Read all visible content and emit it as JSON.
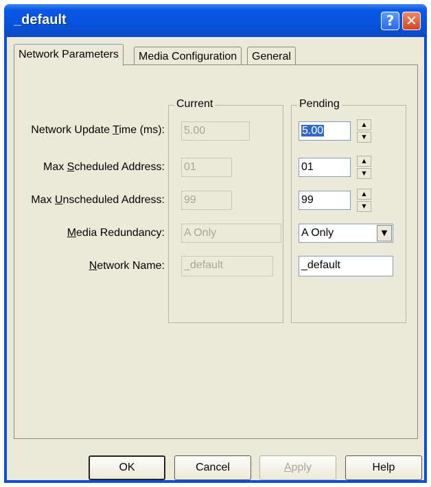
{
  "window": {
    "title": "_default",
    "help_icon": "?",
    "close_icon": "✕"
  },
  "tabs": [
    {
      "label": "Network Parameters",
      "active": true
    },
    {
      "label": "Media Configuration",
      "active": false
    },
    {
      "label": "General",
      "active": false
    }
  ],
  "groups": {
    "current": "Current",
    "pending": "Pending"
  },
  "rows": [
    {
      "label_pre": "Network Update ",
      "label_key": "T",
      "label_post": "ime (ms):",
      "current": "5.00",
      "pending": "5.00"
    },
    {
      "label_pre": "Max ",
      "label_key": "S",
      "label_post": "cheduled Address:",
      "current": "01",
      "pending": "01"
    },
    {
      "label_pre": "Max ",
      "label_key": "U",
      "label_post": "nscheduled Address:",
      "current": "99",
      "pending": "99"
    },
    {
      "label_pre": "",
      "label_key": "M",
      "label_post": "edia Redundancy:",
      "current": "A Only",
      "pending": "A Only"
    },
    {
      "label_pre": "",
      "label_key": "N",
      "label_post": "etwork Name:",
      "current": "_default",
      "pending": "_default"
    }
  ],
  "spinner": {
    "up": "▲",
    "down": "▼"
  },
  "dropdown_arrow": "▼",
  "buttons": {
    "ok": "OK",
    "cancel": "Cancel",
    "apply_key": "A",
    "apply_rest": "pply",
    "help": "Help"
  }
}
